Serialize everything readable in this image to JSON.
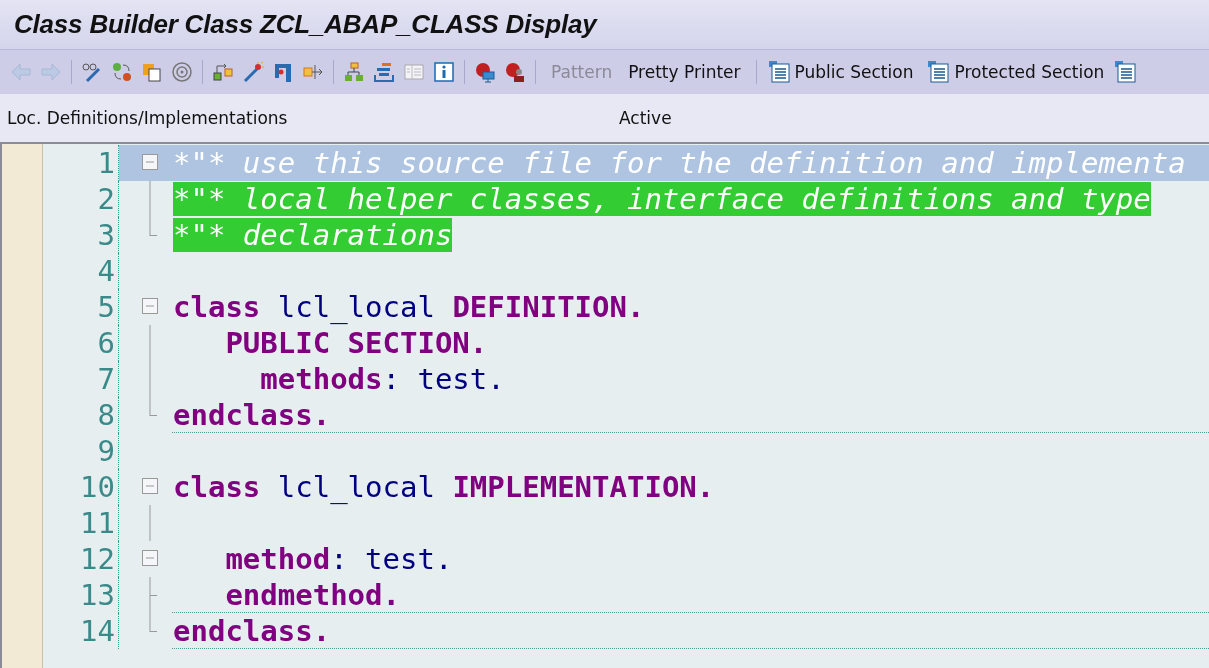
{
  "window": {
    "title": "Class Builder Class ZCL_ABAP_CLASS Display"
  },
  "toolbar": {
    "icon_groups": [
      [
        {
          "disabled": true
        },
        {
          "disabled": true
        }
      ],
      [
        {
          "disabled": false
        },
        {
          "disabled": false
        },
        {
          "disabled": false
        },
        {
          "disabled": false
        }
      ],
      [
        {
          "disabled": false
        },
        {
          "disabled": false
        },
        {
          "disabled": false
        },
        {
          "disabled": false
        }
      ],
      [
        {
          "disabled": false
        },
        {
          "disabled": false
        },
        {
          "disabled": false
        },
        {
          "disabled": false
        }
      ],
      [
        {
          "disabled": false
        },
        {
          "disabled": false
        }
      ]
    ],
    "text_buttons": [
      {
        "label": "Pattern",
        "disabled": true
      },
      {
        "label": "Pretty Printer",
        "disabled": false
      }
    ],
    "section_buttons": [
      {
        "label": "Public Section"
      },
      {
        "label": "Protected Section"
      }
    ]
  },
  "header": {
    "left": "Loc. Definitions/Implementations",
    "status": "Active"
  },
  "editor": {
    "lines": [
      {
        "number": "1",
        "fold_toggle": true,
        "selected": true,
        "highlighted": false,
        "tokens": [
          {
            "kind": "comment",
            "text": "*\"* use this source file for the definition and implementa"
          }
        ]
      },
      {
        "number": "2",
        "guide_line": true,
        "selected": false,
        "highlighted": true,
        "tokens": [
          {
            "kind": "comment",
            "text": "*\"* local helper classes, interface definitions and type"
          }
        ]
      },
      {
        "number": "3",
        "guide_end": true,
        "selected": false,
        "highlighted": true,
        "tokens": [
          {
            "kind": "comment",
            "text": "*\"* declarations"
          }
        ]
      },
      {
        "number": "4"
      },
      {
        "number": "5",
        "fold_toggle": true,
        "tokens": [
          {
            "kind": "keyword",
            "text": "class"
          },
          {
            "kind": "ident",
            "text": " lcl_local "
          },
          {
            "kind": "keyword",
            "text": "DEFINITION."
          }
        ]
      },
      {
        "number": "6",
        "guide_line": true,
        "tokens": [
          {
            "kind": "keyword",
            "text": "   PUBLIC SECTION."
          }
        ]
      },
      {
        "number": "7",
        "guide_line": true,
        "tokens": [
          {
            "kind": "keyword",
            "text": "     methods"
          },
          {
            "kind": "ident",
            "text": ": test."
          }
        ]
      },
      {
        "number": "8",
        "guide_end": true,
        "rule": true,
        "tokens": [
          {
            "kind": "keyword",
            "text": "endclass."
          }
        ]
      },
      {
        "number": "9"
      },
      {
        "number": "10",
        "fold_toggle": true,
        "tokens": [
          {
            "kind": "keyword",
            "text": "class"
          },
          {
            "kind": "ident",
            "text": " lcl_local "
          },
          {
            "kind": "keyword",
            "text": "IMPLEMENTATION."
          }
        ]
      },
      {
        "number": "11",
        "guide_line": true
      },
      {
        "number": "12",
        "fold_toggle": true,
        "tokens": [
          {
            "kind": "keyword",
            "text": "   method"
          },
          {
            "kind": "ident",
            "text": ": test."
          }
        ]
      },
      {
        "number": "13",
        "guide_line": true,
        "guide_end": true,
        "rule": true,
        "tokens": [
          {
            "kind": "keyword",
            "text": "   endmethod."
          }
        ]
      },
      {
        "number": "14",
        "guide_end": true,
        "rule": true,
        "tokens": [
          {
            "kind": "keyword",
            "text": "endclass."
          }
        ]
      }
    ]
  }
}
